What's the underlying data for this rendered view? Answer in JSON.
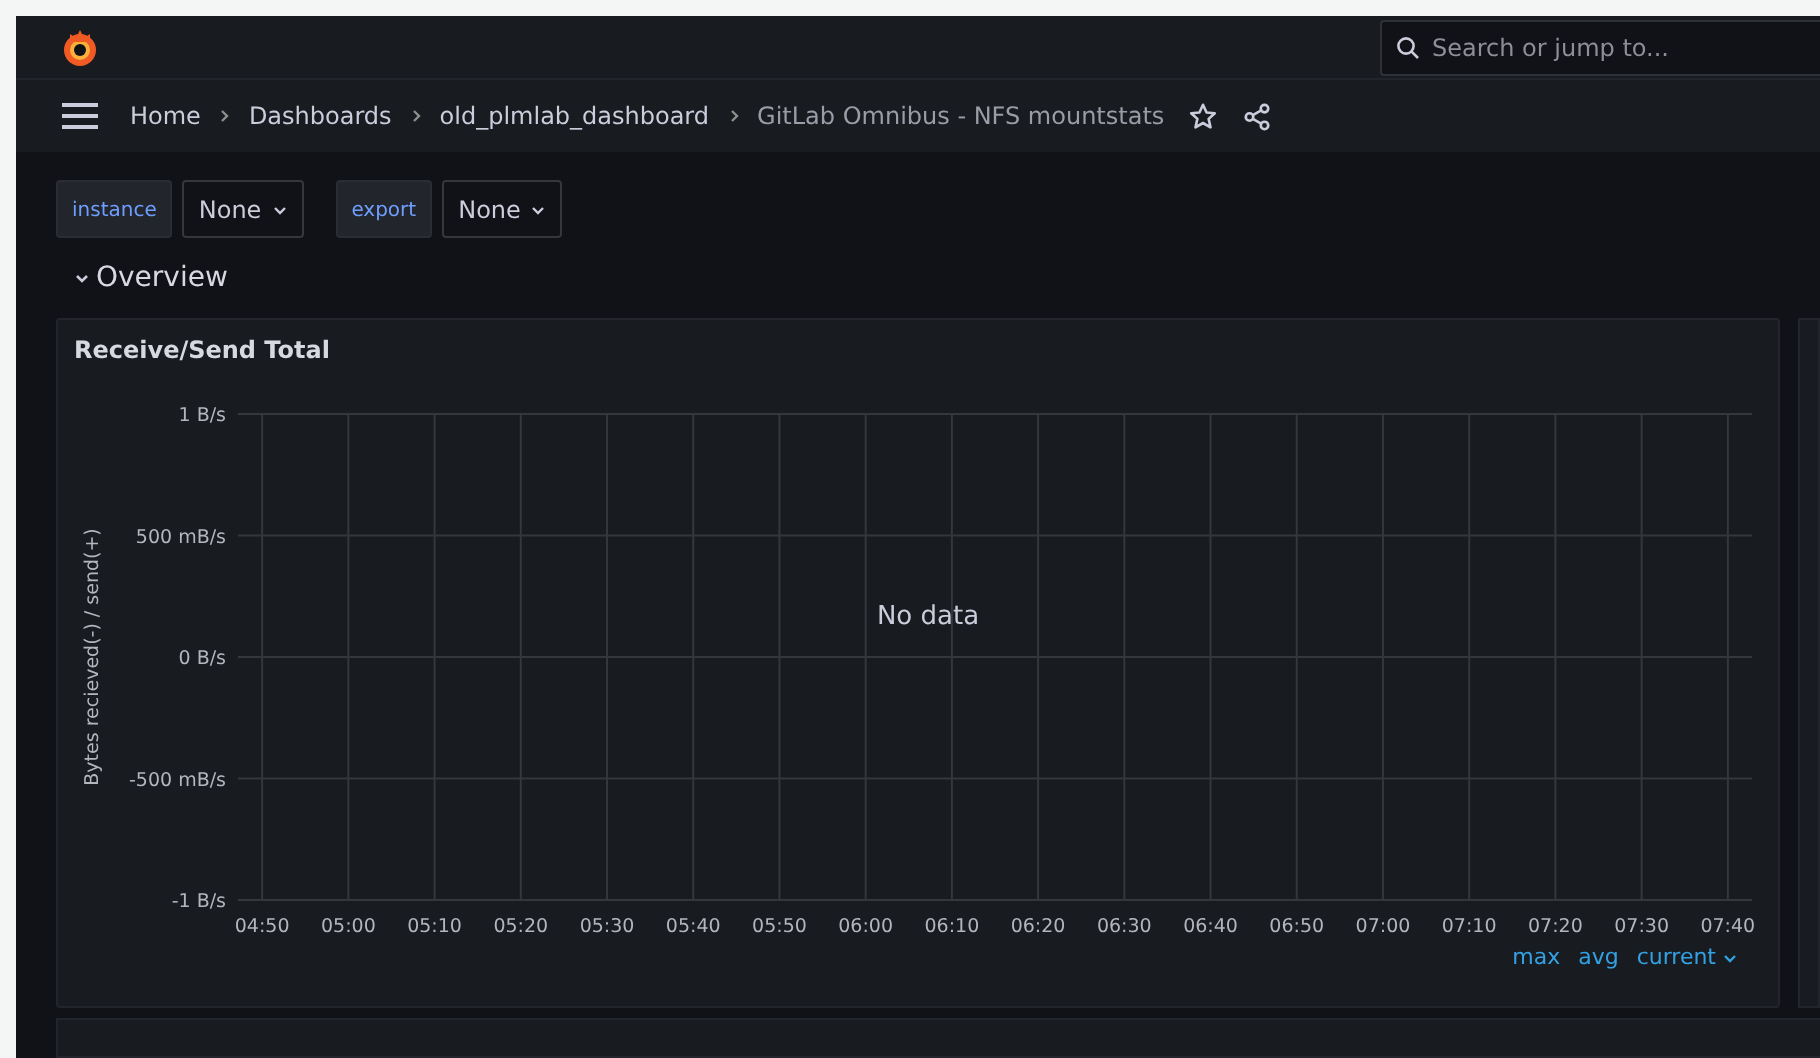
{
  "header": {
    "search": {
      "placeholder": "Search or jump to..."
    }
  },
  "breadcrumbs": [
    {
      "label": "Home",
      "current": false
    },
    {
      "label": "Dashboards",
      "current": false
    },
    {
      "label": "old_plmlab_dashboard",
      "current": false
    },
    {
      "label": "GitLab Omnibus - NFS mountstats",
      "current": true
    }
  ],
  "variables": [
    {
      "label": "instance",
      "value": "None"
    },
    {
      "label": "export",
      "value": "None"
    }
  ],
  "row": {
    "title": "Overview",
    "expanded": true
  },
  "panel": {
    "title": "Receive/Send Total",
    "message": "No data",
    "y_axis_labels": [
      "1 B/s",
      "500 mB/s",
      "0 B/s",
      "-500 mB/s",
      "-1 B/s"
    ],
    "y_axis_title": "Bytes recieved(-) / send(+)",
    "x_axis_labels": [
      "04:50",
      "05:00",
      "05:10",
      "05:20",
      "05:30",
      "05:40",
      "05:50",
      "06:00",
      "06:10",
      "06:20",
      "06:30",
      "06:40",
      "06:50",
      "07:00",
      "07:10",
      "07:20",
      "07:30",
      "07:40"
    ],
    "legend": [
      {
        "label": "max",
        "sorted": false
      },
      {
        "label": "avg",
        "sorted": false
      },
      {
        "label": "current",
        "sorted": true
      }
    ]
  }
}
